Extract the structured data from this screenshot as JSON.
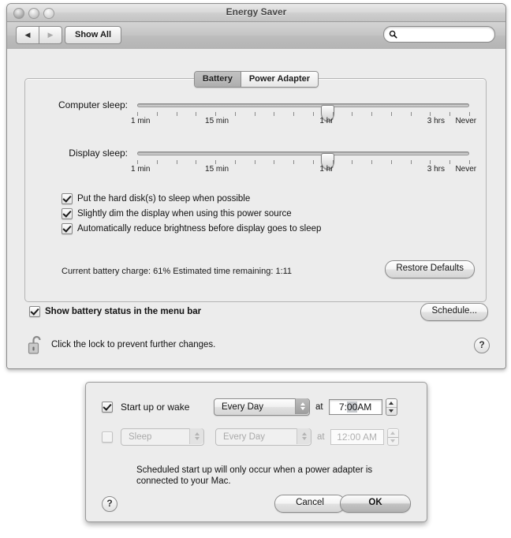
{
  "window": {
    "title": "Energy Saver",
    "toolbar": {
      "back_icon": "◀",
      "forward_icon": "▶",
      "show_all_label": "Show All",
      "search_placeholder": "",
      "search_value": ""
    }
  },
  "tabs": [
    {
      "label": "Battery",
      "selected": true
    },
    {
      "label": "Power Adapter",
      "selected": false
    }
  ],
  "sliders": [
    {
      "label": "Computer sleep:",
      "value_pct": 57,
      "tick_count": 18,
      "tick_labels": [
        {
          "text": "1 min",
          "pos_pct": 1
        },
        {
          "text": "15 min",
          "pos_pct": 24
        },
        {
          "text": "1 hr",
          "pos_pct": 57
        },
        {
          "text": "3 hrs",
          "pos_pct": 90
        },
        {
          "text": "Never",
          "pos_pct": 99
        }
      ]
    },
    {
      "label": "Display sleep:",
      "value_pct": 57,
      "tick_count": 18,
      "tick_labels": [
        {
          "text": "1 min",
          "pos_pct": 1
        },
        {
          "text": "15 min",
          "pos_pct": 24
        },
        {
          "text": "1 hr",
          "pos_pct": 57
        },
        {
          "text": "3 hrs",
          "pos_pct": 90
        },
        {
          "text": "Never",
          "pos_pct": 99
        }
      ]
    }
  ],
  "options": [
    {
      "label": "Put the hard disk(s) to sleep when possible",
      "checked": true
    },
    {
      "label": "Slightly dim the display when using this power source",
      "checked": true
    },
    {
      "label": "Automatically reduce brightness before display goes to sleep",
      "checked": true
    }
  ],
  "battery_status": "Current battery charge: 61%  Estimated time remaining: 1:11",
  "restore_defaults_label": "Restore Defaults",
  "show_battery_status": {
    "label": "Show battery status in the menu bar",
    "checked": true
  },
  "schedule_button_label": "Schedule...",
  "lock": {
    "text": "Click the lock to prevent further changes.",
    "state": "unlocked"
  },
  "help_label": "?",
  "dialog": {
    "rows": [
      {
        "checkbox_label": "Start up or wake",
        "checked": true,
        "enabled": true,
        "action_popup": null,
        "day_popup": "Every Day",
        "at_label": "at",
        "time_prefix": "7:",
        "time_selected": "00",
        "time_suffix": " AM"
      },
      {
        "checkbox_label": "",
        "checked": false,
        "enabled": false,
        "action_popup": "Sleep",
        "day_popup": "Every Day",
        "at_label": "at",
        "time_prefix": "12:",
        "time_selected": "",
        "time_suffix": "00 AM"
      }
    ],
    "note": "Scheduled start up will only occur when a power adapter is connected to your Mac.",
    "cancel_label": "Cancel",
    "ok_label": "OK",
    "help_label": "?"
  }
}
